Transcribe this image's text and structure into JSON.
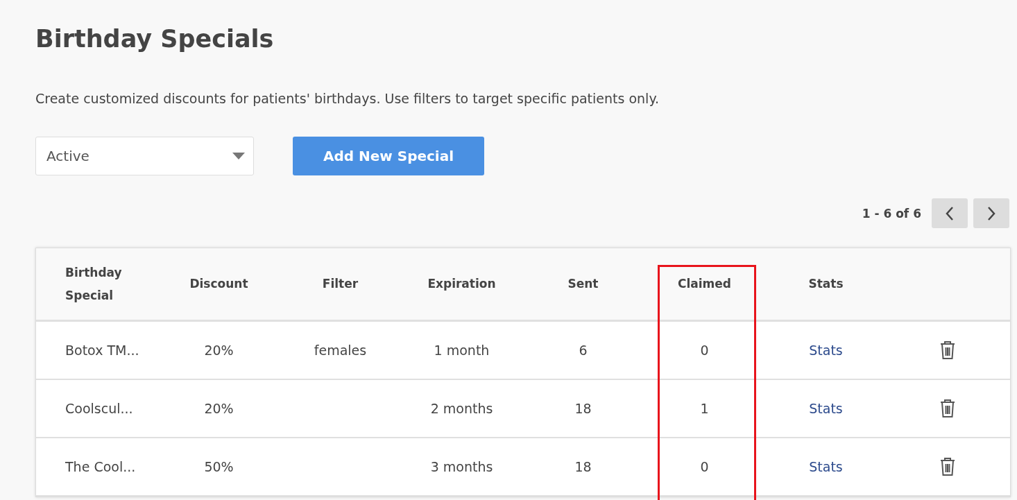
{
  "page": {
    "title": "Birthday Specials",
    "description": "Create customized discounts for patients' birthdays. Use filters to target specific patients only."
  },
  "status_select": {
    "value": "Active"
  },
  "add_button": {
    "label": "Add New Special"
  },
  "pagination": {
    "range": "1 - 6 of 6"
  },
  "table": {
    "columns": [
      {
        "label": "Birthday Special"
      },
      {
        "label": "Discount"
      },
      {
        "label": "Filter"
      },
      {
        "label": "Expiration"
      },
      {
        "label": "Sent"
      },
      {
        "label": "Claimed",
        "highlighted": true
      },
      {
        "label": "Stats"
      }
    ],
    "rows": [
      {
        "name": "Botox TM...",
        "discount": "20%",
        "filter": "females",
        "expiration": "1 month",
        "sent": "6",
        "claimed": "0",
        "stats": "Stats"
      },
      {
        "name": "Coolscul...",
        "discount": "20%",
        "expiration": "2 months",
        "sent": "18",
        "claimed": "1",
        "stats": "Stats"
      },
      {
        "name": "The Cool...",
        "discount": "50%",
        "expiration": "3 months",
        "sent": "18",
        "claimed": "0",
        "stats": "Stats"
      }
    ]
  }
}
